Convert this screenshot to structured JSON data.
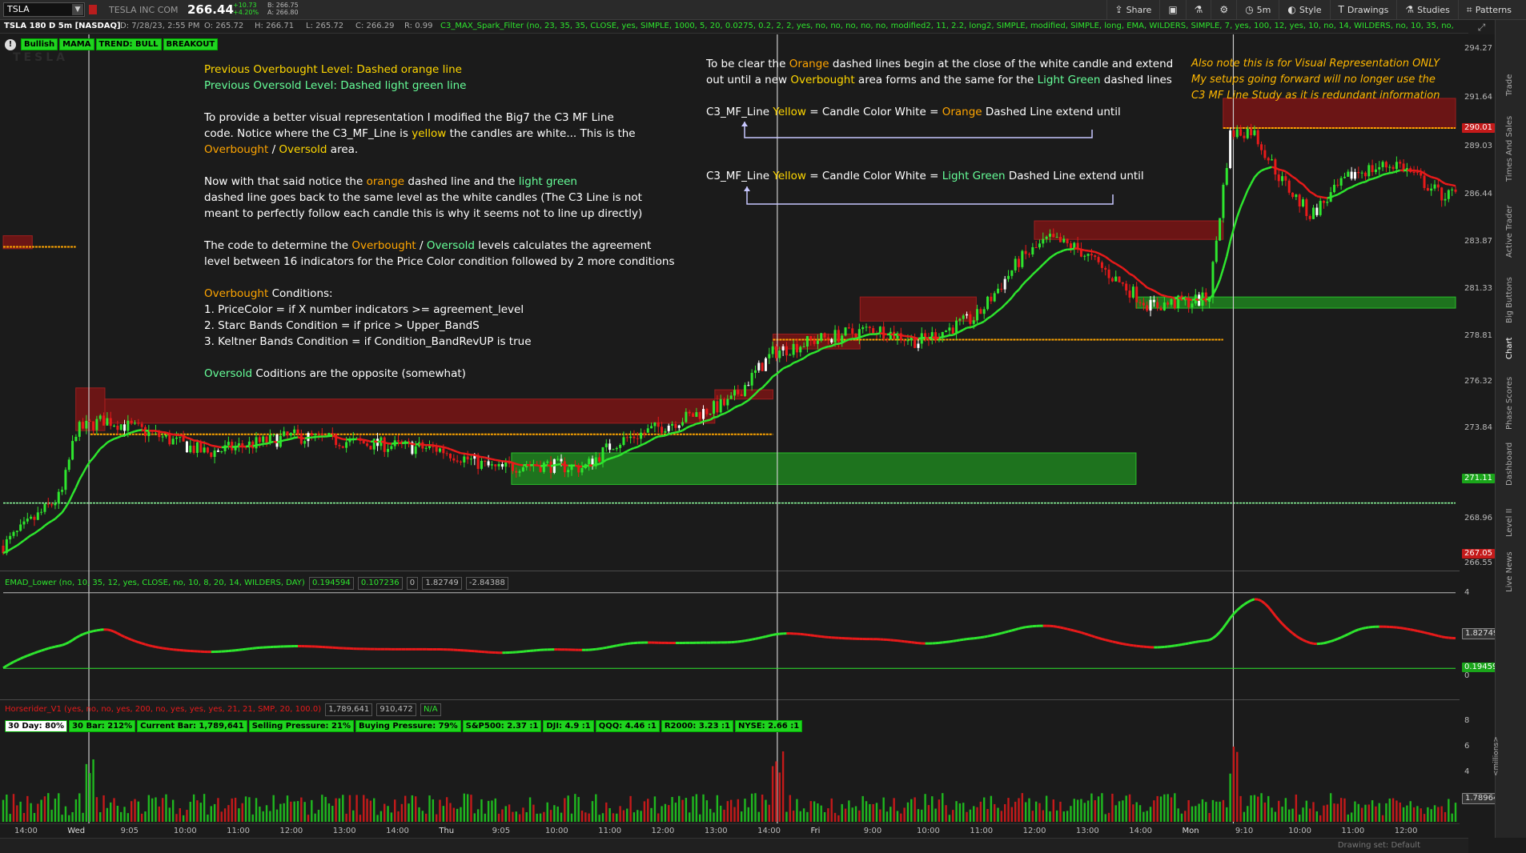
{
  "header": {
    "symbol": "TSLA",
    "company": "TESLA INC COM",
    "last": "266.44",
    "change": "+10.73",
    "change_pct": "+4.20%",
    "bid": "B: 266.75",
    "ask": "A: 266.80",
    "tools": [
      {
        "icon": "share-icon",
        "label": "Share"
      },
      {
        "icon": "snapshot-icon",
        "label": ""
      },
      {
        "icon": "flask-icon",
        "label": ""
      },
      {
        "icon": "gear-icon",
        "label": ""
      },
      {
        "icon": "timeframe-icon",
        "label": "5m"
      },
      {
        "icon": "style-icon",
        "label": "Style"
      },
      {
        "icon": "drawings-icon",
        "label": "Drawings"
      },
      {
        "icon": "studies-icon",
        "label": "Studies"
      },
      {
        "icon": "patterns-icon",
        "label": "Patterns"
      }
    ]
  },
  "studybar": {
    "title": "TSLA 180 D 5m [NASDAQ]",
    "datetime": "D: 7/28/23, 2:55 PM",
    "open": "O: 265.72",
    "high": "H: 266.71",
    "low": "L: 265.72",
    "close": "C: 266.29",
    "range": "R: 0.99",
    "study": "C3_MAX_Spark_Filter (no, 23, 35, 35, CLOSE, yes, SIMPLE, 1000, 5, 20, 0.0275, 0.2, 2, 2, yes, no, no, no, no, no, modified2, 11, 2.2, long2, SIMPLE, modified, SIMPLE, long, EMA, WILDERS, SIMPLE, 7, yes, 100, 12, yes, 10, no, 14, WILDERS, no, 10, 35, no,"
  },
  "badges": [
    "Bullish",
    "MAMA",
    "TREND: BULL",
    "BREAKOUT"
  ],
  "watermark": "TESLA",
  "annotations": {
    "left": {
      "l1": "Previous Overbought Level: Dashed orange line",
      "l2": "Previous Oversold Level: Dashed light green line",
      "p1a": "To provide a better visual representation I modified the Big7 the C3 MF Line",
      "p1b_pre": "code. Notice where the C3_MF_Line is ",
      "p1b_hl": "yellow",
      "p1b_post": " the candles are white... This is the",
      "p1c_ob": "Overbought",
      "p1c_sep": " / ",
      "p1c_os": "Oversold",
      "p1c_post": " area.",
      "p2a_pre": "Now with that said notice the ",
      "p2a_or": "orange",
      "p2a_mid": " dashed line and the ",
      "p2a_lg": "light green",
      "p2b": "dashed line goes back to the same level as the white candles (The C3 Line is not",
      "p2c": "meant to perfectly follow each candle this is why it seems not to line up directly)",
      "p3a_pre": "The code to determine the ",
      "p3a_ob": "Overbought",
      "p3a_sep": " / ",
      "p3a_os": "Oversold",
      "p3a_post": " levels calculates the agreement",
      "p3b": "level between 16 indicators for the Price Color condition followed by 2 more conditions",
      "p4_ob": "Overbought",
      "p4_post": " Conditions:",
      "c1": "1. PriceColor = if X number indicators >= agreement_level",
      "c2": "2. Starc Bands Condition = if price > Upper_BandS",
      "c3": "3. Keltner Bands Condition = if Condition_BandRevUP is true",
      "p5_os": "Oversold",
      "p5_post": "  Coditions are the opposite (somewhat)"
    },
    "middle": {
      "m1_pre": "To be clear the ",
      "m1_or": "Orange",
      "m1_post": " dashed lines begin at the close of the white candle and extend",
      "m2_pre": "out until a new ",
      "m2_ob": "Overbought",
      "m2_mid": " area forms and the same for the ",
      "m2_lg": "Light Green",
      "m2_post": " dashed lines",
      "r1_pre": "C3_MF_Line ",
      "r1_y": "Yellow",
      "r1_mid": " = Candle Color White = ",
      "r1_or": "Orange",
      "r1_post": " Dashed Line extend until",
      "r2_pre": "C3_MF_Line ",
      "r2_y": "Yellow",
      "r2_mid": " = Candle Color White = ",
      "r2_lg": "Light Green",
      "r2_post": " Dashed Line extend until"
    },
    "note": {
      "n1": "Also note this is for Visual Representation ONLY",
      "n2": "My setups going forward will no longer use the",
      "n3": "C3 MF Line Study as it is redundant information"
    }
  },
  "price_axis": {
    "ticks": [
      "294.27",
      "291.64",
      "289.03",
      "286.44",
      "283.87",
      "281.33",
      "278.81",
      "276.32",
      "273.84",
      "268.96",
      "266.55"
    ],
    "tag_red_1": "290.01",
    "tag_green": "271.11",
    "tag_red_2": "267.05"
  },
  "lower1": {
    "title": "EMAD_Lower (no, 10, 35, 12, yes, CLOSE, no, 10, 8, 20, 14, WILDERS, DAY)",
    "v1": "0.194594",
    "v2": "0.107236",
    "v3": "0",
    "v4": "1.82749",
    "v5": "-2.84388",
    "axis_ticks": [
      "4",
      "0"
    ],
    "tag_top": "1.82749",
    "tag_bottom": "0.19459"
  },
  "lower2": {
    "title": "Horserider_V1 (yes, no, no, yes, 200, no, yes, yes, yes, 21, 21, SMP, 20, 100.0)",
    "v1": "1,789,641",
    "v2": "910,472",
    "v3": "N/A",
    "badges": [
      "30 Day: 80%",
      "30 Bar: 212%",
      "Current Bar: 1,789,641",
      "Selling Pressure: 21%",
      "Buying Pressure: 79%",
      "S&P500: 2.37 :1",
      "DJI: 4.9 :1",
      "QQQ: 4.46 :1",
      "R2000: 3.23 :1",
      "NYSE: 2.66 :1"
    ],
    "axis_ticks": [
      "8",
      "6",
      "4",
      "2"
    ],
    "axis_unit": "<millions>",
    "tag": "1.78964"
  },
  "time_axis": [
    "14:00",
    "Wed",
    "9:05",
    "10:00",
    "11:00",
    "12:00",
    "13:00",
    "14:00",
    "Thu",
    "9:05",
    "10:00",
    "11:00",
    "12:00",
    "13:00",
    "14:00",
    "Fri",
    "9:00",
    "10:00",
    "11:00",
    "12:00",
    "13:00",
    "14:00",
    "Mon",
    "9:10",
    "10:00",
    "11:00",
    "12:00"
  ],
  "statusbar": "Drawing set: Default",
  "rail_tabs": [
    "Trade",
    "Times And Sales",
    "Active Trader",
    "Big Buttons",
    "Chart",
    "Phase Scores",
    "Dashboard",
    "Level II",
    "Live News"
  ],
  "colors": {
    "background": "#1b1b1b",
    "bull": "#2ee62e",
    "bear": "#e81a1a",
    "overbought_zone": "#7a1414",
    "oversold_zone": "#1f8a1f",
    "orange_dash": "#ffa500",
    "green_dash": "#8dffa0"
  },
  "chart_data": {
    "type": "candlestick",
    "title": "TSLA 180 D 5m",
    "ylim": [
      266.55,
      294.27
    ],
    "price_path": [
      [
        0,
        267.5
      ],
      [
        0.04,
        270.2
      ],
      [
        0.05,
        273.7
      ],
      [
        0.07,
        274.3
      ],
      [
        0.1,
        273.6
      ],
      [
        0.14,
        272.5
      ],
      [
        0.2,
        273.4
      ],
      [
        0.25,
        273.0
      ],
      [
        0.3,
        272.7
      ],
      [
        0.34,
        271.6
      ],
      [
        0.36,
        271.9
      ],
      [
        0.4,
        271.7
      ],
      [
        0.42,
        273.0
      ],
      [
        0.47,
        274.4
      ],
      [
        0.5,
        275.2
      ],
      [
        0.53,
        277.9
      ],
      [
        0.56,
        278.6
      ],
      [
        0.6,
        279.2
      ],
      [
        0.63,
        278.5
      ],
      [
        0.67,
        279.8
      ],
      [
        0.7,
        282.9
      ],
      [
        0.72,
        284.0
      ],
      [
        0.74,
        283.5
      ],
      [
        0.77,
        281.6
      ],
      [
        0.79,
        280.4
      ],
      [
        0.83,
        280.8
      ],
      [
        0.845,
        289.7
      ],
      [
        0.86,
        289.9
      ],
      [
        0.88,
        287.2
      ],
      [
        0.9,
        285.3
      ],
      [
        0.93,
        287.6
      ],
      [
        0.96,
        288.1
      ],
      [
        0.99,
        286.4
      ]
    ],
    "overbought_zones": [
      {
        "x0": 0.0,
        "x1": 0.02,
        "y0": 283.5,
        "y1": 284.2
      },
      {
        "x0": 0.05,
        "x1": 0.07,
        "y0": 273.7,
        "y1": 276.0
      },
      {
        "x0": 0.07,
        "x1": 0.49,
        "y0": 274.1,
        "y1": 275.4
      },
      {
        "x0": 0.49,
        "x1": 0.53,
        "y0": 275.4,
        "y1": 275.9
      },
      {
        "x0": 0.53,
        "x1": 0.59,
        "y0": 278.1,
        "y1": 278.9
      },
      {
        "x0": 0.59,
        "x1": 0.67,
        "y0": 279.6,
        "y1": 280.9
      },
      {
        "x0": 0.71,
        "x1": 0.84,
        "y0": 284.0,
        "y1": 285.0
      },
      {
        "x0": 0.84,
        "x1": 1.0,
        "y0": 290.0,
        "y1": 291.6
      }
    ],
    "oversold_zones": [
      {
        "x0": 0.35,
        "x1": 0.78,
        "y0": 270.8,
        "y1": 272.5
      },
      {
        "x0": 0.78,
        "x1": 1.0,
        "y0": 280.3,
        "y1": 280.9
      }
    ],
    "orange_dashes": [
      {
        "x0": 0.0,
        "x1": 0.05,
        "y": 283.6
      },
      {
        "x0": 0.06,
        "x1": 0.53,
        "y": 273.5
      },
      {
        "x0": 0.53,
        "x1": 0.84,
        "y": 278.6
      },
      {
        "x0": 0.84,
        "x1": 1.0,
        "y": 290.0
      }
    ],
    "green_dashes": [
      {
        "x0": 0.0,
        "x1": 1.0,
        "y": 269.8
      }
    ],
    "session_breaks": [
      0.059,
      0.533,
      0.847
    ]
  }
}
